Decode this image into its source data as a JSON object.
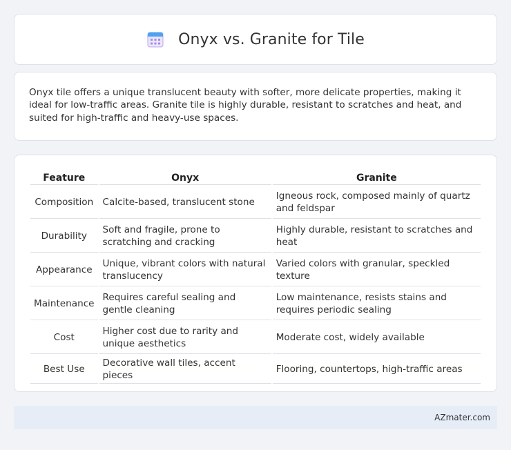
{
  "header": {
    "title": "Onyx vs. Granite for Tile",
    "icon": "calendar-icon"
  },
  "intro": {
    "text": "Onyx tile offers a unique translucent beauty with softer, more delicate properties, making it ideal for low-traffic areas. Granite tile is highly durable, resistant to scratches and heat, and suited for high-traffic and heavy-use spaces."
  },
  "table": {
    "headers": [
      "Feature",
      "Onyx",
      "Granite"
    ],
    "rows": [
      [
        "Composition",
        "Calcite-based, translucent stone",
        "Igneous rock, composed mainly of quartz and feldspar"
      ],
      [
        "Durability",
        "Soft and fragile, prone to scratching and cracking",
        "Highly durable, resistant to scratches and heat"
      ],
      [
        "Appearance",
        "Unique, vibrant colors with natural translucency",
        "Varied colors with granular, speckled texture"
      ],
      [
        "Maintenance",
        "Requires careful sealing and gentle cleaning",
        "Low maintenance, resists stains and requires periodic sealing"
      ],
      [
        "Cost",
        "Higher cost due to rarity and unique aesthetics",
        "Moderate cost, widely available"
      ],
      [
        "Best Use",
        "Decorative wall tiles, accent pieces",
        "Flooring, countertops, high-traffic areas"
      ]
    ]
  },
  "footer": {
    "text": "AZmater.com"
  }
}
